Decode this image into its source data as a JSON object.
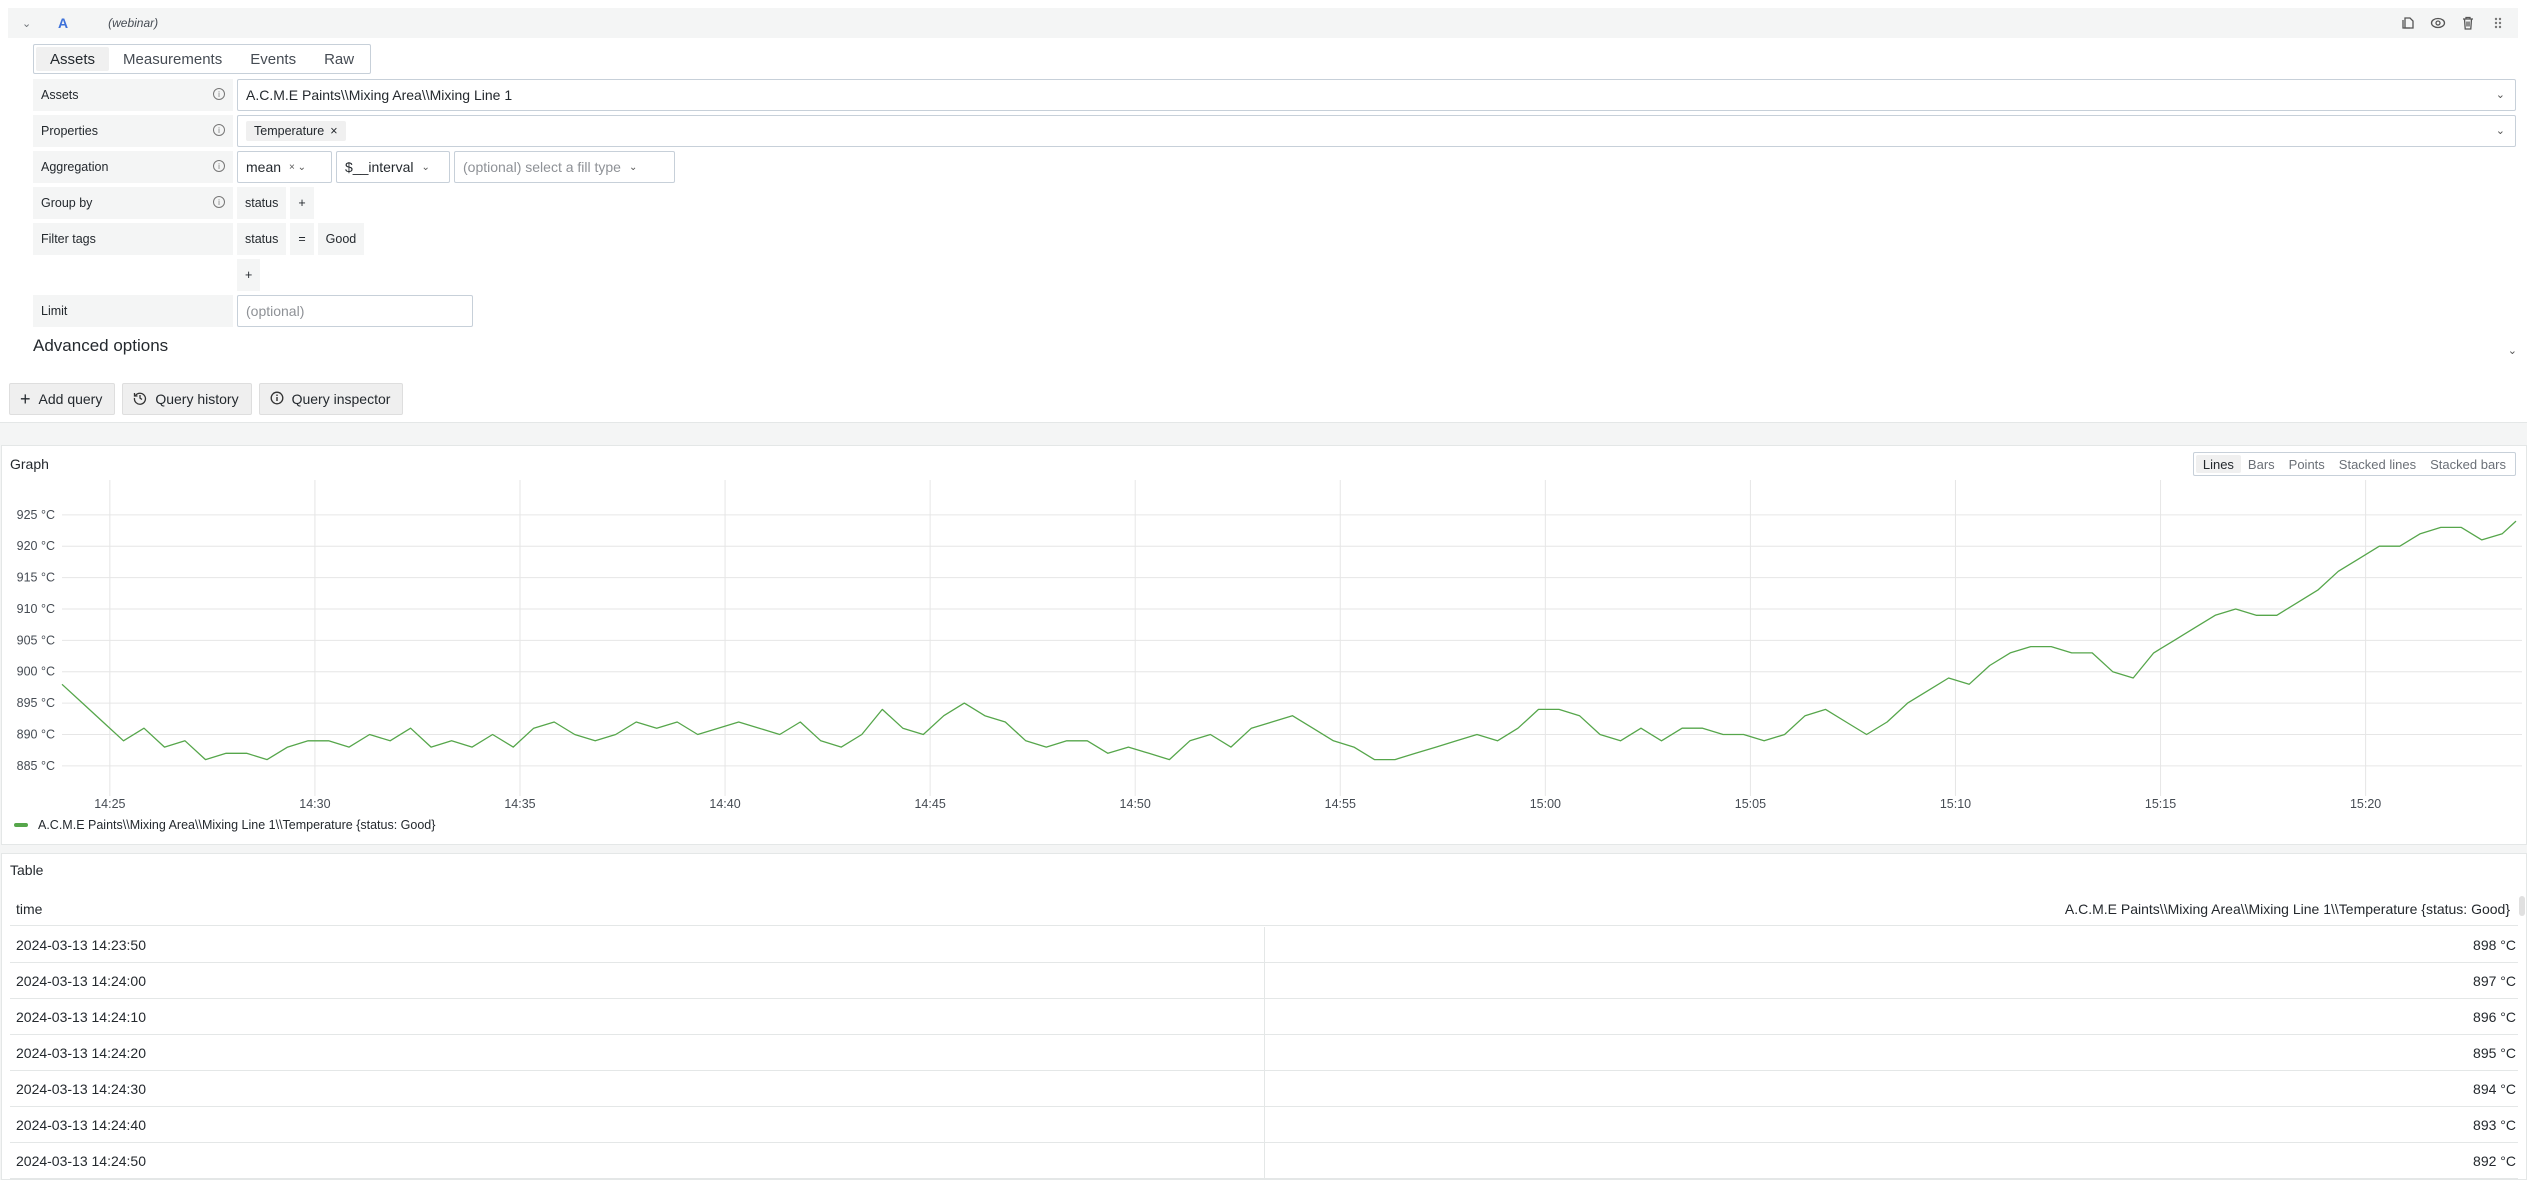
{
  "query": {
    "ref_id": "A",
    "datasource": "(webinar)",
    "header_actions": [
      "duplicate-icon",
      "eye-icon",
      "trash-icon",
      "drag-handle-icon"
    ],
    "tabs": [
      {
        "label": "Assets",
        "active": true
      },
      {
        "label": "Measurements",
        "active": false
      },
      {
        "label": "Events",
        "active": false
      },
      {
        "label": "Raw",
        "active": false
      }
    ],
    "fields": {
      "assets": {
        "label": "Assets",
        "value": "A.C.M.E Paints\\\\Mixing Area\\\\Mixing Line 1"
      },
      "properties": {
        "label": "Properties",
        "chips": [
          "Temperature"
        ]
      },
      "aggregation": {
        "label": "Aggregation",
        "func": "mean",
        "interval": "$__interval",
        "fill_placeholder": "(optional) select a fill type"
      },
      "group_by": {
        "label": "Group by",
        "tag": "status",
        "add": "+"
      },
      "filter_tags": {
        "label": "Filter tags",
        "key": "status",
        "op": "=",
        "value": "Good",
        "add": "+"
      },
      "limit": {
        "label": "Limit",
        "placeholder": "(optional)"
      }
    },
    "advanced_options": "Advanced options"
  },
  "buttons": {
    "add_query": "Add query",
    "query_history": "Query history",
    "query_inspector": "Query inspector"
  },
  "graph": {
    "title": "Graph",
    "viz_options": [
      {
        "label": "Lines",
        "active": true
      },
      {
        "label": "Bars",
        "active": false
      },
      {
        "label": "Points",
        "active": false
      },
      {
        "label": "Stacked lines",
        "active": false
      },
      {
        "label": "Stacked bars",
        "active": false
      }
    ],
    "color": "#56a64b"
  },
  "chart_data": {
    "type": "line",
    "title": "Graph",
    "xlabel": "",
    "ylabel": "",
    "y_unit": "°C",
    "ylim": [
      881,
      928
    ],
    "yticks": [
      885,
      890,
      895,
      900,
      905,
      910,
      915,
      920,
      925
    ],
    "ytick_labels": [
      "885 °C",
      "890 °C",
      "895 °C",
      "900 °C",
      "905 °C",
      "910 °C",
      "915 °C",
      "920 °C",
      "925 °C"
    ],
    "x_start": "14:23:50",
    "x_end": "15:23:40",
    "xticks": [
      "14:25",
      "14:30",
      "14:35",
      "14:40",
      "14:45",
      "14:50",
      "14:55",
      "15:00",
      "15:05",
      "15:10",
      "15:15",
      "15:20"
    ],
    "grid": true,
    "legend": "bottom-left",
    "series": [
      {
        "name": "A.C.M.E Paints\\\\Mixing Area\\\\Mixing Line 1\\\\Temperature {status: Good}",
        "x": [
          "14:23:50",
          "14:24:20",
          "14:24:50",
          "14:25:20",
          "14:25:50",
          "14:26:20",
          "14:26:50",
          "14:27:20",
          "14:27:50",
          "14:28:20",
          "14:28:50",
          "14:29:20",
          "14:29:50",
          "14:30:20",
          "14:30:50",
          "14:31:20",
          "14:31:50",
          "14:32:20",
          "14:32:50",
          "14:33:20",
          "14:33:50",
          "14:34:20",
          "14:34:50",
          "14:35:20",
          "14:35:50",
          "14:36:20",
          "14:36:50",
          "14:37:20",
          "14:37:50",
          "14:38:20",
          "14:38:50",
          "14:39:20",
          "14:39:50",
          "14:40:20",
          "14:40:50",
          "14:41:20",
          "14:41:50",
          "14:42:20",
          "14:42:50",
          "14:43:20",
          "14:43:50",
          "14:44:20",
          "14:44:50",
          "14:45:20",
          "14:45:50",
          "14:46:20",
          "14:46:50",
          "14:47:20",
          "14:47:50",
          "14:48:20",
          "14:48:50",
          "14:49:20",
          "14:49:50",
          "14:50:20",
          "14:50:50",
          "14:51:20",
          "14:51:50",
          "14:52:20",
          "14:52:50",
          "14:53:20",
          "14:53:50",
          "14:54:20",
          "14:54:50",
          "14:55:20",
          "14:55:50",
          "14:56:20",
          "14:56:50",
          "14:57:20",
          "14:57:50",
          "14:58:20",
          "14:58:50",
          "14:59:20",
          "14:59:50",
          "15:00:20",
          "15:00:50",
          "15:01:20",
          "15:01:50",
          "15:02:20",
          "15:02:50",
          "15:03:20",
          "15:03:50",
          "15:04:20",
          "15:04:50",
          "15:05:20",
          "15:05:50",
          "15:06:20",
          "15:06:50",
          "15:07:20",
          "15:07:50",
          "15:08:20",
          "15:08:50",
          "15:09:20",
          "15:09:50",
          "15:10:20",
          "15:10:50",
          "15:11:20",
          "15:11:50",
          "15:12:20",
          "15:12:50",
          "15:13:20",
          "15:13:50",
          "15:14:20",
          "15:14:50",
          "15:15:20",
          "15:15:50",
          "15:16:20",
          "15:16:50",
          "15:17:20",
          "15:17:50",
          "15:18:20",
          "15:18:50",
          "15:19:20",
          "15:19:50",
          "15:20:20",
          "15:20:50",
          "15:21:20",
          "15:21:50",
          "15:22:20",
          "15:22:50",
          "15:23:20",
          "15:23:40"
        ],
        "values": [
          898,
          895,
          892,
          889,
          891,
          888,
          889,
          886,
          887,
          887,
          886,
          888,
          889,
          889,
          888,
          890,
          889,
          891,
          888,
          889,
          888,
          890,
          888,
          891,
          892,
          890,
          889,
          890,
          892,
          891,
          892,
          890,
          891,
          892,
          891,
          890,
          892,
          889,
          888,
          890,
          894,
          891,
          890,
          893,
          895,
          893,
          892,
          889,
          888,
          889,
          889,
          887,
          888,
          887,
          886,
          889,
          890,
          888,
          891,
          892,
          893,
          891,
          889,
          888,
          886,
          886,
          887,
          888,
          889,
          890,
          889,
          891,
          894,
          894,
          893,
          890,
          889,
          891,
          889,
          891,
          891,
          890,
          890,
          889,
          890,
          893,
          894,
          892,
          890,
          892,
          895,
          897,
          899,
          898,
          901,
          903,
          904,
          904,
          903,
          903,
          900,
          899,
          903,
          905,
          907,
          909,
          910,
          909,
          909,
          911,
          913,
          916,
          918,
          920,
          920,
          922,
          923,
          923,
          921,
          922,
          924,
          922
        ]
      }
    ]
  },
  "table": {
    "title": "Table",
    "columns": [
      "time",
      "A.C.M.E Paints\\\\Mixing Area\\\\Mixing Line 1\\\\Temperature {status: Good}"
    ],
    "rows": [
      [
        "2024-03-13 14:23:50",
        "898 °C"
      ],
      [
        "2024-03-13 14:24:00",
        "897 °C"
      ],
      [
        "2024-03-13 14:24:10",
        "896 °C"
      ],
      [
        "2024-03-13 14:24:20",
        "895 °C"
      ],
      [
        "2024-03-13 14:24:30",
        "894 °C"
      ],
      [
        "2024-03-13 14:24:40",
        "893 °C"
      ],
      [
        "2024-03-13 14:24:50",
        "892 °C"
      ]
    ]
  }
}
